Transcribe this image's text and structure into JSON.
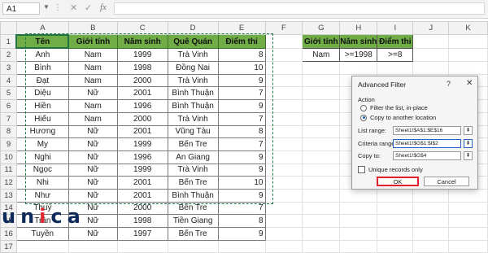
{
  "formula_bar": {
    "name_box": "A1",
    "dots": "⋮",
    "cancel": "✕",
    "enter": "✓",
    "fx": "fx"
  },
  "columns": [
    "",
    "A",
    "B",
    "C",
    "D",
    "E",
    "F",
    "G",
    "H",
    "I",
    "J",
    "K"
  ],
  "rows": [
    "1",
    "2",
    "3",
    "4",
    "5",
    "6",
    "7",
    "8",
    "9",
    "10",
    "11",
    "12",
    "13",
    "14",
    "15",
    "16",
    "17"
  ],
  "table": {
    "headers": [
      "Tên",
      "Giới tính",
      "Năm sinh",
      "Quê Quán",
      "Điểm thi"
    ],
    "data": [
      [
        "Anh",
        "Nam",
        "1999",
        "Trà Vinh",
        "8"
      ],
      [
        "Bình",
        "Nam",
        "1998",
        "Đồng Nai",
        "10"
      ],
      [
        "Đạt",
        "Nam",
        "2000",
        "Trà Vinh",
        "9"
      ],
      [
        "Diệu",
        "Nữ",
        "2001",
        "Bình Thuận",
        "7"
      ],
      [
        "Hiền",
        "Nam",
        "1996",
        "Bình Thuận",
        "9"
      ],
      [
        "Hiếu",
        "Nam",
        "2000",
        "Trà Vinh",
        "7"
      ],
      [
        "Hương",
        "Nữ",
        "2001",
        "Vũng Tàu",
        "8"
      ],
      [
        "My",
        "Nữ",
        "1999",
        "Bến Tre",
        "7"
      ],
      [
        "Nghi",
        "Nữ",
        "1996",
        "An Giang",
        "9"
      ],
      [
        "Ngọc",
        "Nữ",
        "1999",
        "Trà Vinh",
        "9"
      ],
      [
        "Nhi",
        "Nữ",
        "2001",
        "Bến Tre",
        "10"
      ],
      [
        "Như",
        "Nữ",
        "2001",
        "Bình Thuận",
        "9"
      ],
      [
        "Thuỷ",
        "Nữ",
        "2000",
        "Bến Tre",
        "7"
      ],
      [
        "Trân",
        "Nữ",
        "1998",
        "Tiền Giang",
        "8"
      ],
      [
        "Tuyền",
        "Nữ",
        "1997",
        "Bến Tre",
        "9"
      ]
    ]
  },
  "criteria": {
    "headers": [
      "Giới tính",
      "Năm sinh",
      "Điểm thi"
    ],
    "values": [
      "Nam",
      ">=1998",
      ">=8"
    ]
  },
  "dialog": {
    "title": "Advanced Filter",
    "help": "?",
    "close": "✕",
    "action_label": "Action",
    "option_inplace": "Filter the list, in-place",
    "option_copy": "Copy to another location",
    "list_range_label": "List range:",
    "list_range_value": "Sheet1!$A$1:$E$16",
    "criteria_range_label": "Criteria range:",
    "criteria_range_value": "Sheet1!$G$1:$I$2",
    "copy_to_label": "Copy to:",
    "copy_to_value": "Sheet1!$G$4",
    "collapse_glyph": "⇞",
    "unique_label": "Unique records only",
    "ok_label": "OK",
    "cancel_label": "Cancel"
  },
  "logo": {
    "part1": "un",
    "accent": "i",
    "part2": "ca"
  },
  "colors": {
    "header_green": "#70ad47",
    "ok_highlight": "#e0202a",
    "selection": "#217346",
    "logo_navy": "#0e2a5a",
    "logo_red": "#e3262f"
  }
}
